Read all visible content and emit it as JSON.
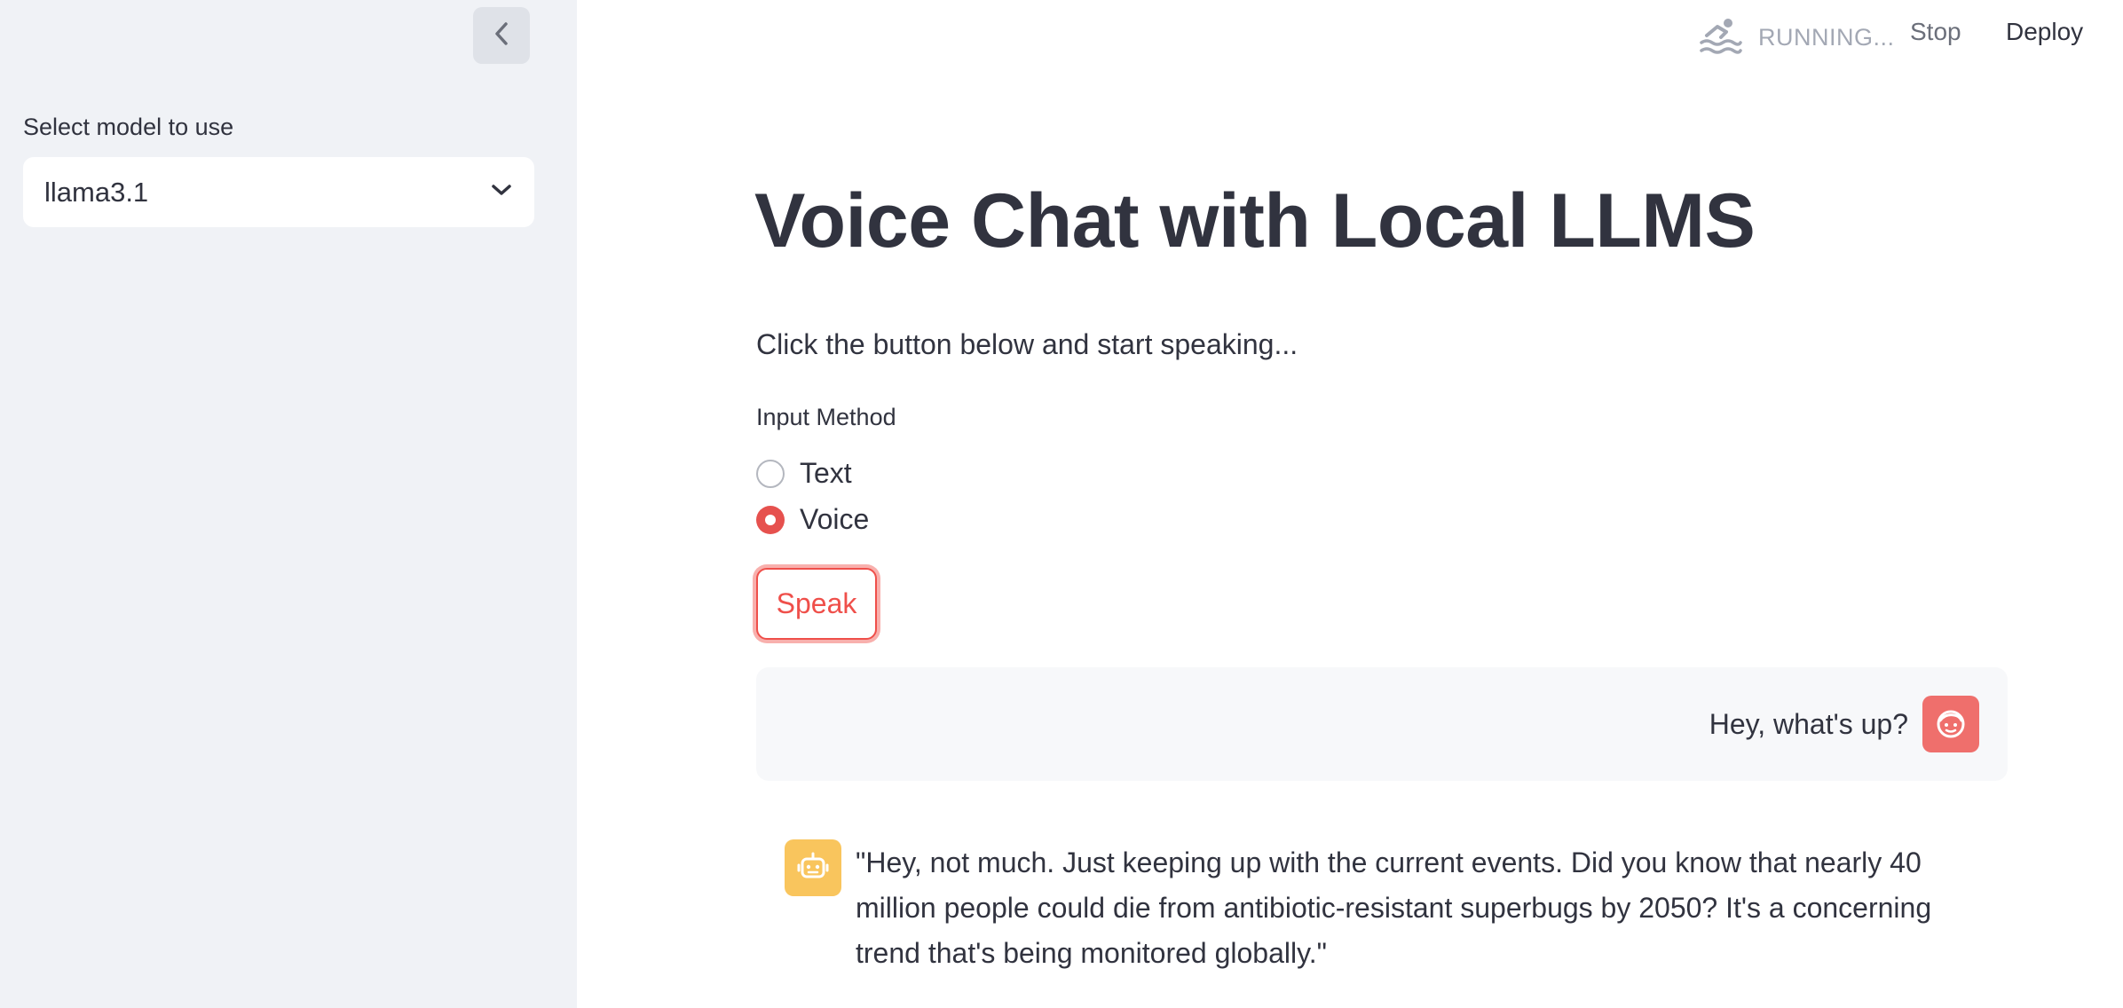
{
  "sidebar": {
    "select_label": "Select model to use",
    "selected_model": "llama3.1"
  },
  "header": {
    "status": "RUNNING...",
    "stop_label": "Stop",
    "deploy_label": "Deploy"
  },
  "main": {
    "title": "Voice Chat with Local LLMS",
    "subtitle": "Click the button below and start speaking...",
    "input_method": {
      "label": "Input Method",
      "options": [
        "Text",
        "Voice"
      ],
      "selected": "Voice"
    },
    "speak_label": "Speak"
  },
  "chat": {
    "user_message": "Hey, what's up?",
    "assistant_message": "\"Hey, not much. Just keeping up with the current events. Did you know that nearly 40 million people could die from antibiotic-resistant superbugs by 2050? It's a concerning trend that's being monitored globally.\""
  },
  "colors": {
    "accent": "#ef4f4a",
    "sidebar_bg": "#f0f2f6",
    "user_avatar": "#ef6f6c",
    "assistant_avatar": "#f9c55d"
  },
  "icons": {
    "collapse": "chevron-left-icon",
    "select": "chevron-down-icon",
    "status": "swimmer-icon",
    "user": "user-face-icon",
    "assistant": "robot-icon"
  }
}
